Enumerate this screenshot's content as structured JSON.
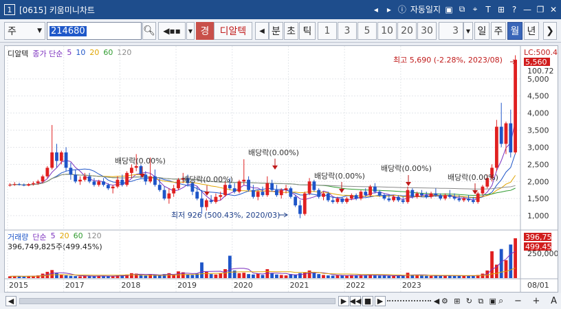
{
  "window": {
    "number": "1",
    "title": "[0615] 키움미니차트",
    "auto_save": "자동일지"
  },
  "toolbar": {
    "market": "주",
    "stock_code": "214680",
    "quick_badge": "경",
    "stock_name": "디알텍",
    "periods": [
      "분",
      "초",
      "틱"
    ],
    "intervals": [
      "1",
      "3",
      "5",
      "10",
      "20",
      "30"
    ],
    "current_n": "3",
    "units": [
      "일",
      "주",
      "월",
      "년"
    ],
    "active_unit": "월"
  },
  "price_legend": {
    "stock": "디알텍",
    "ma_label": "종가 단순",
    "periods": [
      "5",
      "10",
      "20",
      "60",
      "120"
    ]
  },
  "price_axis": {
    "ticks": [
      "5,000",
      "4,500",
      "4,000",
      "3,500",
      "3,000",
      "2,500",
      "2,000",
      "1,500",
      "1,000"
    ],
    "lc": "LC:500.4",
    "current": "5,560",
    "current_pct": "100.72"
  },
  "annotations": {
    "high": "최고 5,690 (-2.28%, 2023/08)",
    "low": "최저 926 (500.43%, 2020/03)",
    "dividend": "배당락(0.00%)"
  },
  "volume_legend": {
    "label": "거래량",
    "ma_label": "단순",
    "periods": [
      "5",
      "20",
      "60",
      "120"
    ],
    "summary": "396,749,825주(499.45%)"
  },
  "volume_axis": {
    "ticks": [
      "250,000"
    ],
    "current": "396,75",
    "current_pct": "499.45"
  },
  "time_axis": {
    "labels": [
      "2015",
      "2017",
      "2018",
      "2019",
      "2020",
      "2021",
      "2022",
      "2023",
      "08/01"
    ]
  },
  "colors": {
    "up": "#e02020",
    "down": "#1e55c8",
    "ma5": "#7b2fbe",
    "ma10": "#1e55c8",
    "ma20": "#e0a400",
    "ma60": "#2e9a2e",
    "ma120": "#8a8a8a",
    "title_bg": "#1e4d8c"
  },
  "chart_data": {
    "type": "candlestick",
    "y_range": [
      700,
      5800
    ],
    "price_series": [
      [
        1880,
        1950,
        1850,
        1900
      ],
      [
        1900,
        1980,
        1870,
        1920
      ],
      [
        1920,
        1960,
        1880,
        1900
      ],
      [
        1900,
        1940,
        1860,
        1880
      ],
      [
        1880,
        1950,
        1860,
        1920
      ],
      [
        1920,
        2000,
        1880,
        1950
      ],
      [
        1950,
        2050,
        1900,
        2000
      ],
      [
        2000,
        2200,
        1950,
        2150
      ],
      [
        2150,
        2450,
        2100,
        2400
      ],
      [
        2400,
        3650,
        2350,
        2850
      ],
      [
        2850,
        3100,
        2400,
        2600
      ],
      [
        2600,
        2900,
        2500,
        2850
      ],
      [
        2850,
        3000,
        2300,
        2400
      ],
      [
        2400,
        2550,
        2050,
        2200
      ],
      [
        2200,
        2350,
        1950,
        2000
      ],
      [
        2000,
        2150,
        1900,
        2050
      ],
      [
        2050,
        2250,
        2000,
        2150
      ],
      [
        2150,
        2250,
        1950,
        2000
      ],
      [
        2000,
        2100,
        1850,
        1900
      ],
      [
        1900,
        2050,
        1850,
        2000
      ],
      [
        2000,
        2100,
        1850,
        1900
      ],
      [
        1900,
        1950,
        1750,
        1800
      ],
      [
        1800,
        1900,
        1650,
        1850
      ],
      [
        1850,
        2150,
        1800,
        2050
      ],
      [
        2050,
        2200,
        1850,
        1900
      ],
      [
        1900,
        2300,
        1850,
        2250
      ],
      [
        2250,
        2500,
        2100,
        2400
      ],
      [
        2400,
        2800,
        2300,
        2450
      ],
      [
        2450,
        2500,
        2100,
        2200
      ],
      [
        2200,
        2300,
        1900,
        2000
      ],
      [
        2000,
        2700,
        1950,
        2150
      ],
      [
        2150,
        2350,
        1850,
        1900
      ],
      [
        1900,
        2100,
        1700,
        1750
      ],
      [
        1750,
        1850,
        1450,
        1500
      ],
      [
        1500,
        1800,
        1350,
        1650
      ],
      [
        1650,
        1900,
        1550,
        1800
      ],
      [
        1800,
        2100,
        1750,
        2050
      ],
      [
        2050,
        2250,
        1950,
        2100
      ],
      [
        2100,
        2200,
        1850,
        1950
      ],
      [
        1950,
        2000,
        1600,
        1700
      ],
      [
        1700,
        1850,
        1450,
        1500
      ],
      [
        1500,
        1750,
        1050,
        1250
      ],
      [
        1250,
        1500,
        1150,
        1450
      ],
      [
        1450,
        1600,
        1350,
        1400
      ],
      [
        1400,
        1650,
        1350,
        1550
      ],
      [
        1550,
        1700,
        1450,
        1600
      ],
      [
        1600,
        2000,
        1550,
        1900
      ],
      [
        1900,
        2100,
        1750,
        1800
      ],
      [
        1800,
        1950,
        1650,
        1700
      ],
      [
        1700,
        2050,
        1650,
        2000
      ],
      [
        2000,
        2650,
        1900,
        2050
      ],
      [
        2050,
        2150,
        1700,
        1750
      ],
      [
        1750,
        1900,
        1500,
        1550
      ],
      [
        1550,
        1750,
        1450,
        1700
      ],
      [
        1700,
        1850,
        1550,
        1600
      ],
      [
        1600,
        2150,
        1550,
        1950
      ],
      [
        1950,
        2050,
        1700,
        1750
      ],
      [
        1750,
        1900,
        1550,
        1600
      ],
      [
        1600,
        1800,
        1500,
        1750
      ],
      [
        1750,
        1900,
        1650,
        1800
      ],
      [
        1800,
        1850,
        1500,
        1550
      ],
      [
        1550,
        1600,
        1250,
        1300
      ],
      [
        1300,
        1450,
        926,
        1050
      ],
      [
        1050,
        1700,
        1000,
        1650
      ],
      [
        1650,
        2100,
        1600,
        2000
      ],
      [
        2000,
        2050,
        1700,
        1750
      ],
      [
        1750,
        1800,
        1500,
        1550
      ],
      [
        1550,
        1700,
        1450,
        1650
      ],
      [
        1650,
        1700,
        1400,
        1450
      ],
      [
        1450,
        1550,
        1350,
        1400
      ],
      [
        1400,
        1550,
        1350,
        1500
      ],
      [
        1500,
        1550,
        1350,
        1400
      ],
      [
        1400,
        1550,
        1350,
        1500
      ],
      [
        1500,
        1650,
        1450,
        1600
      ],
      [
        1600,
        1650,
        1450,
        1500
      ],
      [
        1500,
        1750,
        1450,
        1700
      ],
      [
        1700,
        1800,
        1550,
        1600
      ],
      [
        1600,
        1900,
        1550,
        1850
      ],
      [
        1850,
        1950,
        1650,
        1700
      ],
      [
        1700,
        1750,
        1550,
        1600
      ],
      [
        1600,
        1650,
        1450,
        1500
      ],
      [
        1500,
        1600,
        1400,
        1450
      ],
      [
        1450,
        1600,
        1400,
        1550
      ],
      [
        1550,
        1600,
        1400,
        1450
      ],
      [
        1450,
        1550,
        1350,
        1400
      ],
      [
        1400,
        1850,
        1350,
        1750
      ],
      [
        1750,
        1800,
        1500,
        1550
      ],
      [
        1550,
        1700,
        1500,
        1650
      ],
      [
        1650,
        1750,
        1550,
        1600
      ],
      [
        1600,
        1700,
        1500,
        1550
      ],
      [
        1550,
        1700,
        1500,
        1650
      ],
      [
        1650,
        1800,
        1550,
        1600
      ],
      [
        1600,
        1650,
        1450,
        1500
      ],
      [
        1500,
        1650,
        1450,
        1600
      ],
      [
        1600,
        1750,
        1500,
        1550
      ],
      [
        1550,
        1650,
        1450,
        1500
      ],
      [
        1500,
        1600,
        1400,
        1450
      ],
      [
        1450,
        1550,
        1400,
        1500
      ],
      [
        1500,
        1600,
        1400,
        1450
      ],
      [
        1450,
        1550,
        1350,
        1400
      ],
      [
        1400,
        1700,
        1350,
        1650
      ],
      [
        1650,
        1900,
        1600,
        1850
      ],
      [
        1850,
        2200,
        1800,
        2100
      ],
      [
        2100,
        2500,
        2000,
        2400
      ],
      [
        2400,
        3800,
        2300,
        3600
      ],
      [
        3600,
        4300,
        3000,
        3100
      ],
      [
        3100,
        3750,
        2800,
        3700
      ],
      [
        3700,
        4100,
        2700,
        2850
      ],
      [
        2850,
        5690,
        2800,
        5560
      ]
    ],
    "volume": [
      8,
      9,
      8,
      7,
      9,
      10,
      12,
      20,
      28,
      36,
      22,
      14,
      12,
      10,
      9,
      8,
      11,
      9,
      8,
      10,
      9,
      8,
      9,
      12,
      14,
      16,
      22,
      20,
      14,
      11,
      18,
      16,
      12,
      18,
      22,
      15,
      30,
      26,
      16,
      14,
      20,
      70,
      28,
      18,
      16,
      22,
      40,
      100,
      34,
      22,
      24,
      18,
      16,
      20,
      14,
      40,
      22,
      16,
      14,
      12,
      18,
      14,
      22,
      26,
      34,
      24,
      18,
      14,
      12,
      11,
      12,
      12,
      11,
      14,
      12,
      14,
      12,
      16,
      12,
      11,
      11,
      10,
      10,
      12,
      11,
      24,
      14,
      12,
      11,
      10,
      10,
      12,
      10,
      12,
      11,
      10,
      10,
      11,
      10,
      11,
      14,
      20,
      34,
      120,
      60,
      130,
      80,
      150,
      178
    ]
  }
}
